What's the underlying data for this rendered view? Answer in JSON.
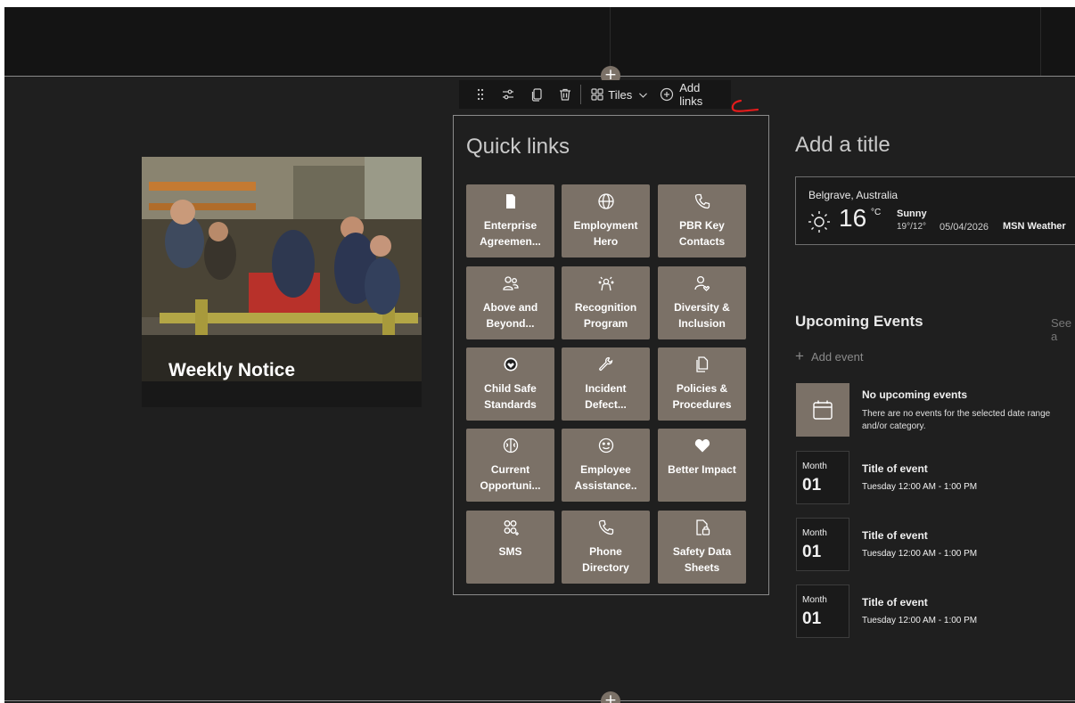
{
  "toolbar": {
    "layout_label": "Tiles",
    "add_links_label": "Add links"
  },
  "image_card": {
    "title": "Weekly Notice"
  },
  "quick_links": {
    "title": "Quick links",
    "tile_color": "#7b7167",
    "tiles": [
      {
        "label": "Enterprise Agreemen...",
        "icon": "document-icon"
      },
      {
        "label": "Employment Hero",
        "icon": "globe-icon"
      },
      {
        "label": "PBR Key Contacts",
        "icon": "phone-icon"
      },
      {
        "label": "Above and Beyond...",
        "icon": "people-icon"
      },
      {
        "label": "Recognition Program",
        "icon": "celebrate-icon"
      },
      {
        "label": "Diversity & Inclusion",
        "icon": "person-heart-icon"
      },
      {
        "label": "Child Safe Standards",
        "icon": "badge-heart-icon"
      },
      {
        "label": "Incident Defect...",
        "icon": "wrench-icon"
      },
      {
        "label": "Policies & Procedures",
        "icon": "documents-icon"
      },
      {
        "label": "Current Opportuni...",
        "icon": "brain-icon"
      },
      {
        "label": "Employee Assistance..",
        "icon": "smile-icon"
      },
      {
        "label": "Better Impact",
        "icon": "heart-icon"
      },
      {
        "label": "SMS",
        "icon": "people-add-icon"
      },
      {
        "label": "Phone Directory",
        "icon": "phone-icon"
      },
      {
        "label": "Safety Data Sheets",
        "icon": "document-lock-icon"
      }
    ]
  },
  "right": {
    "title": "Add a title"
  },
  "weather": {
    "location": "Belgrave, Australia",
    "temperature": "16",
    "unit": "°C",
    "condition": "Sunny",
    "range": "19°/12°",
    "date": "05/04/2026",
    "source": "MSN Weather"
  },
  "events": {
    "title": "Upcoming Events",
    "see_all": "See a",
    "add_event": "Add event",
    "empty_title": "No upcoming events",
    "empty_desc": "There are no events for the selected date range and/or category.",
    "items": [
      {
        "month": "Month",
        "day": "01",
        "title": "Title of event",
        "time": "Tuesday 12:00 AM - 1:00 PM"
      },
      {
        "month": "Month",
        "day": "01",
        "title": "Title of event",
        "time": "Tuesday 12:00 AM - 1:00 PM"
      },
      {
        "month": "Month",
        "day": "01",
        "title": "Title of event",
        "time": "Tuesday 12:00 AM - 1:00 PM"
      }
    ]
  },
  "plus_glyph": "+"
}
